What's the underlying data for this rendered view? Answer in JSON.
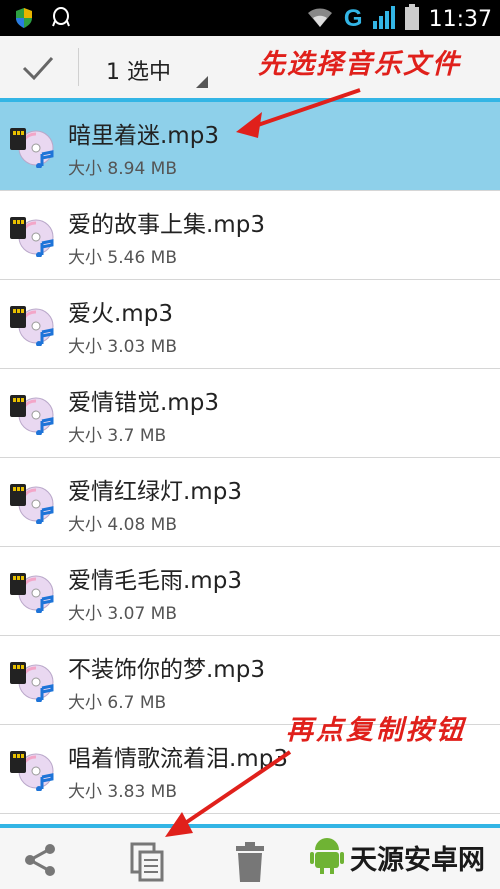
{
  "status_bar": {
    "network": "G",
    "time": "11:37",
    "icons": [
      "shield-icon",
      "qq-penguin-icon",
      "wifi-icon",
      "signal-icon",
      "battery-icon"
    ]
  },
  "action_bar": {
    "selected_label": "1 选中",
    "icons": [
      "check-icon",
      "dropdown-icon"
    ]
  },
  "annotations": {
    "top": "先选择音乐文件",
    "bottom": "再点复制按钮"
  },
  "files": [
    {
      "name": "暗里着迷.mp3",
      "size": "大小 8.94 MB",
      "selected": true
    },
    {
      "name": "爱的故事上集.mp3",
      "size": "大小 5.46 MB",
      "selected": false
    },
    {
      "name": "爱火.mp3",
      "size": "大小 3.03 MB",
      "selected": false
    },
    {
      "name": "爱情错觉.mp3",
      "size": "大小 3.7 MB",
      "selected": false
    },
    {
      "name": "爱情红绿灯.mp3",
      "size": "大小 4.08 MB",
      "selected": false
    },
    {
      "name": "爱情毛毛雨.mp3",
      "size": "大小 3.07 MB",
      "selected": false
    },
    {
      "name": "不装饰你的梦.mp3",
      "size": "大小 6.7 MB",
      "selected": false
    },
    {
      "name": "唱着情歌流着泪.mp3",
      "size": "大小 3.83 MB",
      "selected": false
    }
  ],
  "bottom_bar": {
    "icons": [
      "share-icon",
      "copy-icon",
      "delete-icon"
    ]
  },
  "watermark": {
    "text": "天源安卓网",
    "url": "www.jytyzx.com"
  },
  "colors": {
    "accent": "#33b5e5",
    "selected_row": "#8ed0ea",
    "annotation": "#e0201b"
  }
}
